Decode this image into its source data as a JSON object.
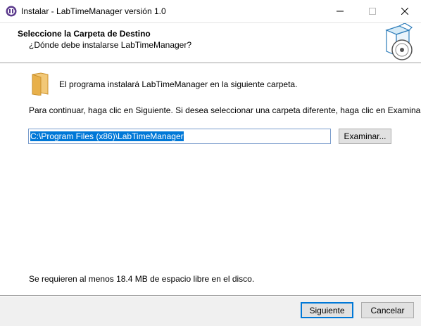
{
  "window": {
    "title": "Instalar - LabTimeManager versión 1.0",
    "icon": "installer-icon",
    "controls": [
      "minimize-icon",
      "maximize-icon",
      "close-icon"
    ]
  },
  "header": {
    "title": "Seleccione la Carpeta de Destino",
    "subtitle": "¿Dónde debe instalarse LabTimeManager?",
    "image": "installer-box-disc-icon"
  },
  "content": {
    "folder_icon": "folder-icon",
    "intro": "El programa instalará LabTimeManager en la siguiente carpeta.",
    "instruction": "Para continuar, haga clic en Siguiente. Si desea seleccionar una carpeta diferente, haga clic en Examinar.",
    "path_value": "C:\\Program Files (x86)\\LabTimeManager",
    "browse_label": "Examinar...",
    "space_required": "Se requieren al menos 18.4 MB de espacio libre en el disco."
  },
  "footer": {
    "next_label": "Siguiente",
    "cancel_label": "Cancelar"
  },
  "colors": {
    "accent": "#0078d7",
    "selection": "#0078d7",
    "folder": "#e8b04a"
  }
}
